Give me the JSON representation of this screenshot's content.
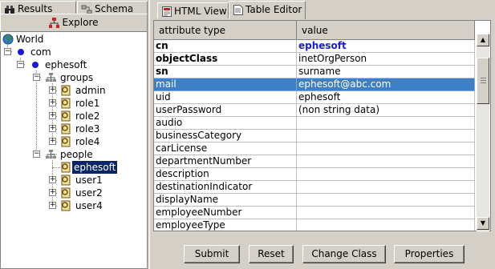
{
  "left_tabs": {
    "results": "Results",
    "schema": "Schema",
    "explore": "Explore"
  },
  "tree": {
    "world": "World",
    "com": "com",
    "ephesoft": "ephesoft",
    "groups": "groups",
    "admin": "admin",
    "role1": "role1",
    "role2": "role2",
    "role3": "role3",
    "role4": "role4",
    "people": "people",
    "ephesoft_person": "ephesoft",
    "user1": "user1",
    "user2": "user2",
    "user4": "user4"
  },
  "right_tabs": {
    "html_view": "HTML View",
    "table_editor": "Table Editor"
  },
  "table": {
    "col_attr": "attribute type",
    "col_value": "value",
    "rows": [
      {
        "attr": "cn",
        "value": "ephesoft"
      },
      {
        "attr": "objectClass",
        "value": "inetOrgPerson"
      },
      {
        "attr": "sn",
        "value": "surname"
      },
      {
        "attr": "mail",
        "value": "ephesoft@abc.com"
      },
      {
        "attr": "uid",
        "value": "ephesoft"
      },
      {
        "attr": "userPassword",
        "value": "(non string data)"
      },
      {
        "attr": "audio",
        "value": ""
      },
      {
        "attr": "businessCategory",
        "value": ""
      },
      {
        "attr": "carLicense",
        "value": ""
      },
      {
        "attr": "departmentNumber",
        "value": ""
      },
      {
        "attr": "description",
        "value": ""
      },
      {
        "attr": "destinationIndicator",
        "value": ""
      },
      {
        "attr": "displayName",
        "value": ""
      },
      {
        "attr": "employeeNumber",
        "value": ""
      },
      {
        "attr": "employeeType",
        "value": ""
      }
    ]
  },
  "buttons": {
    "submit": "Submit",
    "reset": "Reset",
    "change_class": "Change Class",
    "properties": "Properties"
  },
  "colors": {
    "selection_tree": "#0a246a",
    "selection_row": "#3d80c7",
    "bold_blue_value": "#1a1ad8",
    "panel_bg": "#d4d0c8"
  }
}
